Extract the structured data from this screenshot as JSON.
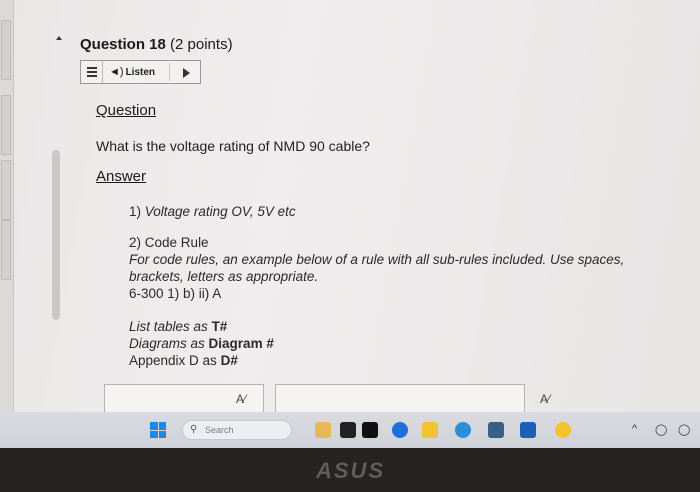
{
  "question": {
    "number_label": "Question 18",
    "points_label": "(2 points)"
  },
  "listen": {
    "label": "Listen"
  },
  "question_heading": "Question",
  "question_text": "What is the voltage rating of NMD 90 cable?",
  "answer_heading": "Answer",
  "answer": {
    "item1_num": "1)",
    "item1_text": "Voltage rating OV, 5V etc",
    "item2_num": "2)",
    "item2_title": "Code Rule",
    "item2_desc": "For code rules, an example below of a rule with all sub-rules included. Use spaces, brackets, letters as appropriate.",
    "item2_example": "6-300 1) b) ii) A",
    "list_tables_prefix": "List tables as",
    "list_tables_code": "T#",
    "diagrams_prefix": "Diagrams as",
    "diagrams_code": "Diagram #",
    "appendix_prefix": "Appendix D as",
    "appendix_code": "D#"
  },
  "taskbar": {
    "search_placeholder": "Search"
  },
  "brand_logo": "ASUS",
  "colors": {
    "windows_blue": "#1e88e5",
    "text": "#1b1b1b"
  },
  "icons": [
    "menu-icon",
    "speaker-icon",
    "play-icon",
    "spellcheck-icon",
    "windows-icon",
    "search-icon"
  ]
}
